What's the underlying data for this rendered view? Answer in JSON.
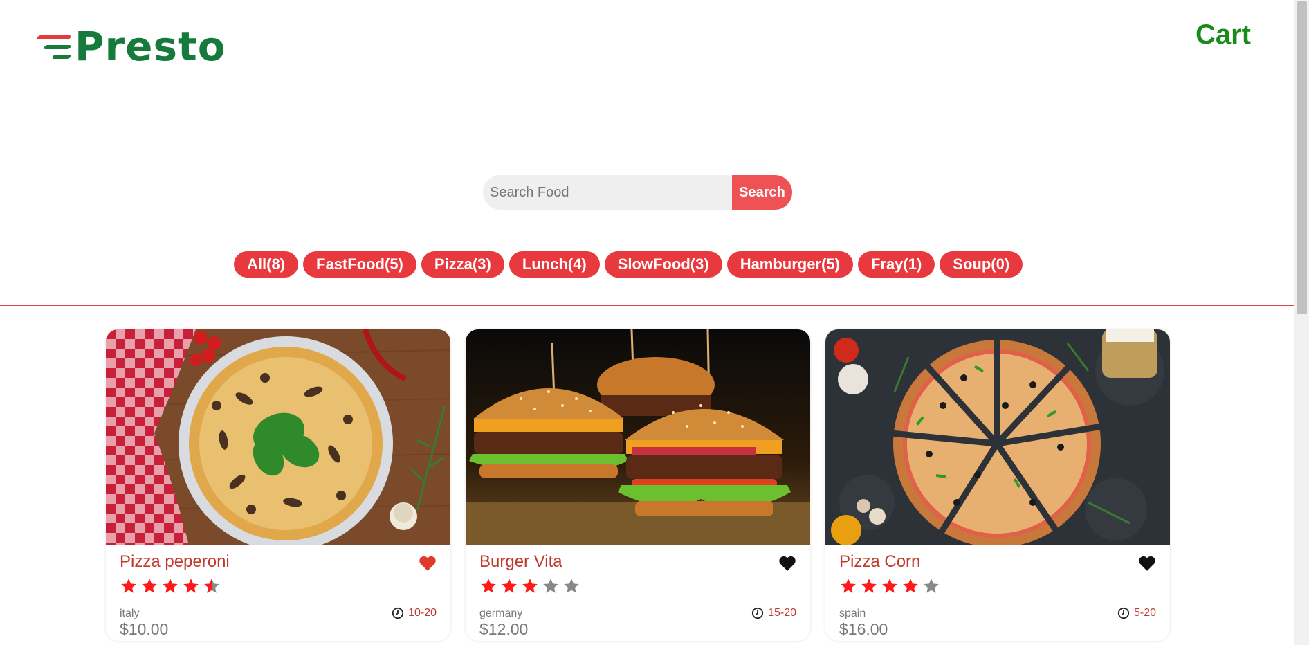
{
  "header": {
    "logo_text": "Presto",
    "cart_label": "Cart"
  },
  "search": {
    "placeholder": "Search Food",
    "value": "",
    "button_label": "Search"
  },
  "tags": [
    {
      "label": "All(8)"
    },
    {
      "label": "FastFood(5)"
    },
    {
      "label": "Pizza(3)"
    },
    {
      "label": "Lunch(4)"
    },
    {
      "label": "SlowFood(3)"
    },
    {
      "label": "Hamburger(5)"
    },
    {
      "label": "Fray(1)"
    },
    {
      "label": "Soup(0)"
    }
  ],
  "foods": [
    {
      "name": "Pizza peperoni",
      "favorite": true,
      "stars": 4.5,
      "origin": "italy",
      "price": "$10.00",
      "cook_time": "10-20",
      "image": "pizza-with-spinach"
    },
    {
      "name": "Burger Vita",
      "favorite": false,
      "stars": 3,
      "origin": "germany",
      "price": "$12.00",
      "cook_time": "15-20",
      "image": "two-burgers"
    },
    {
      "name": "Pizza Corn",
      "favorite": false,
      "stars": 4,
      "origin": "spain",
      "price": "$16.00",
      "cook_time": "5-20",
      "image": "sliced-pizza-dark"
    }
  ],
  "colors": {
    "brand_green": "#157a3b",
    "accent_red": "#e8393e",
    "star_filled": "#ff1a1a",
    "star_empty": "#888888",
    "fav_active": "#e03a2a",
    "fav_inactive": "#111111"
  },
  "icons": {
    "favorite": "heart-icon",
    "time": "clock-icon",
    "rating": "star-icon"
  }
}
